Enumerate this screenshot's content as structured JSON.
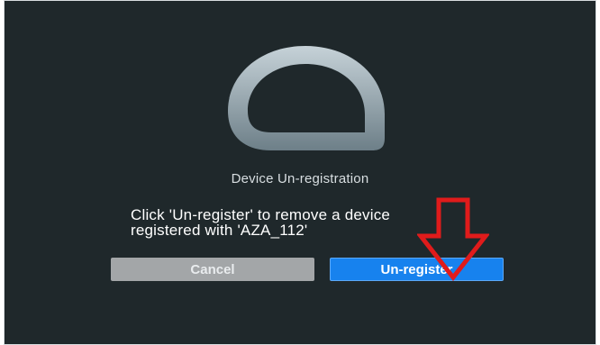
{
  "dialog": {
    "icon": "app-logo-icon",
    "title": "Device Un-registration",
    "message_line1": "Click 'Un-register' to remove a device",
    "message_line2": "registered with 'AZA_112'",
    "cancel_label": "Cancel",
    "unregister_label": "Un-register"
  },
  "annotation": {
    "icon": "red-arrow-down-icon",
    "color": "#e01b1b"
  },
  "colors": {
    "background": "#1f282b",
    "primary_button": "#1782ee",
    "secondary_button": "#a3a6a8"
  }
}
